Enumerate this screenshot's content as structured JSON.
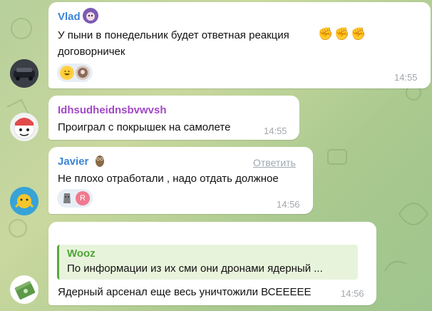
{
  "messages": [
    {
      "sender": "Vlad",
      "sender_color": "#3a84d6",
      "lines": [
        "У пыни в понедельник будет ответная реакция",
        "договорничек"
      ],
      "inline_emoji": "✊✊✊",
      "reactions": [
        "grinning-face-emoji",
        "user-avatar-sticker"
      ],
      "time": "14:55"
    },
    {
      "sender": "Idhsudheidnsbvwvsh",
      "sender_color": "#a248c6",
      "text": "Проиграл с покрышек на самолете",
      "time": "14:55"
    },
    {
      "sender": "Javier",
      "sender_color": "#3a84d6",
      "reply_label": "Ответить",
      "text": "Не плохо отработали , надо отдать должное",
      "reactions": [
        "moai-emoji",
        "reaction-avatar-r"
      ],
      "reaction_avatar_letter": "R",
      "time": "14:56"
    },
    {
      "quote_name": "Wooz",
      "quote_text": "По информации из их сми они дронами ядерный ...",
      "text": "Ядерный арсенал еще весь уничтожили ВСЕЕЕЕЕ",
      "time": "14:56"
    }
  ],
  "colors": {
    "bubble_bg": "#ffffff",
    "time": "#a3a7ab",
    "quote_accent": "#4ea534"
  }
}
